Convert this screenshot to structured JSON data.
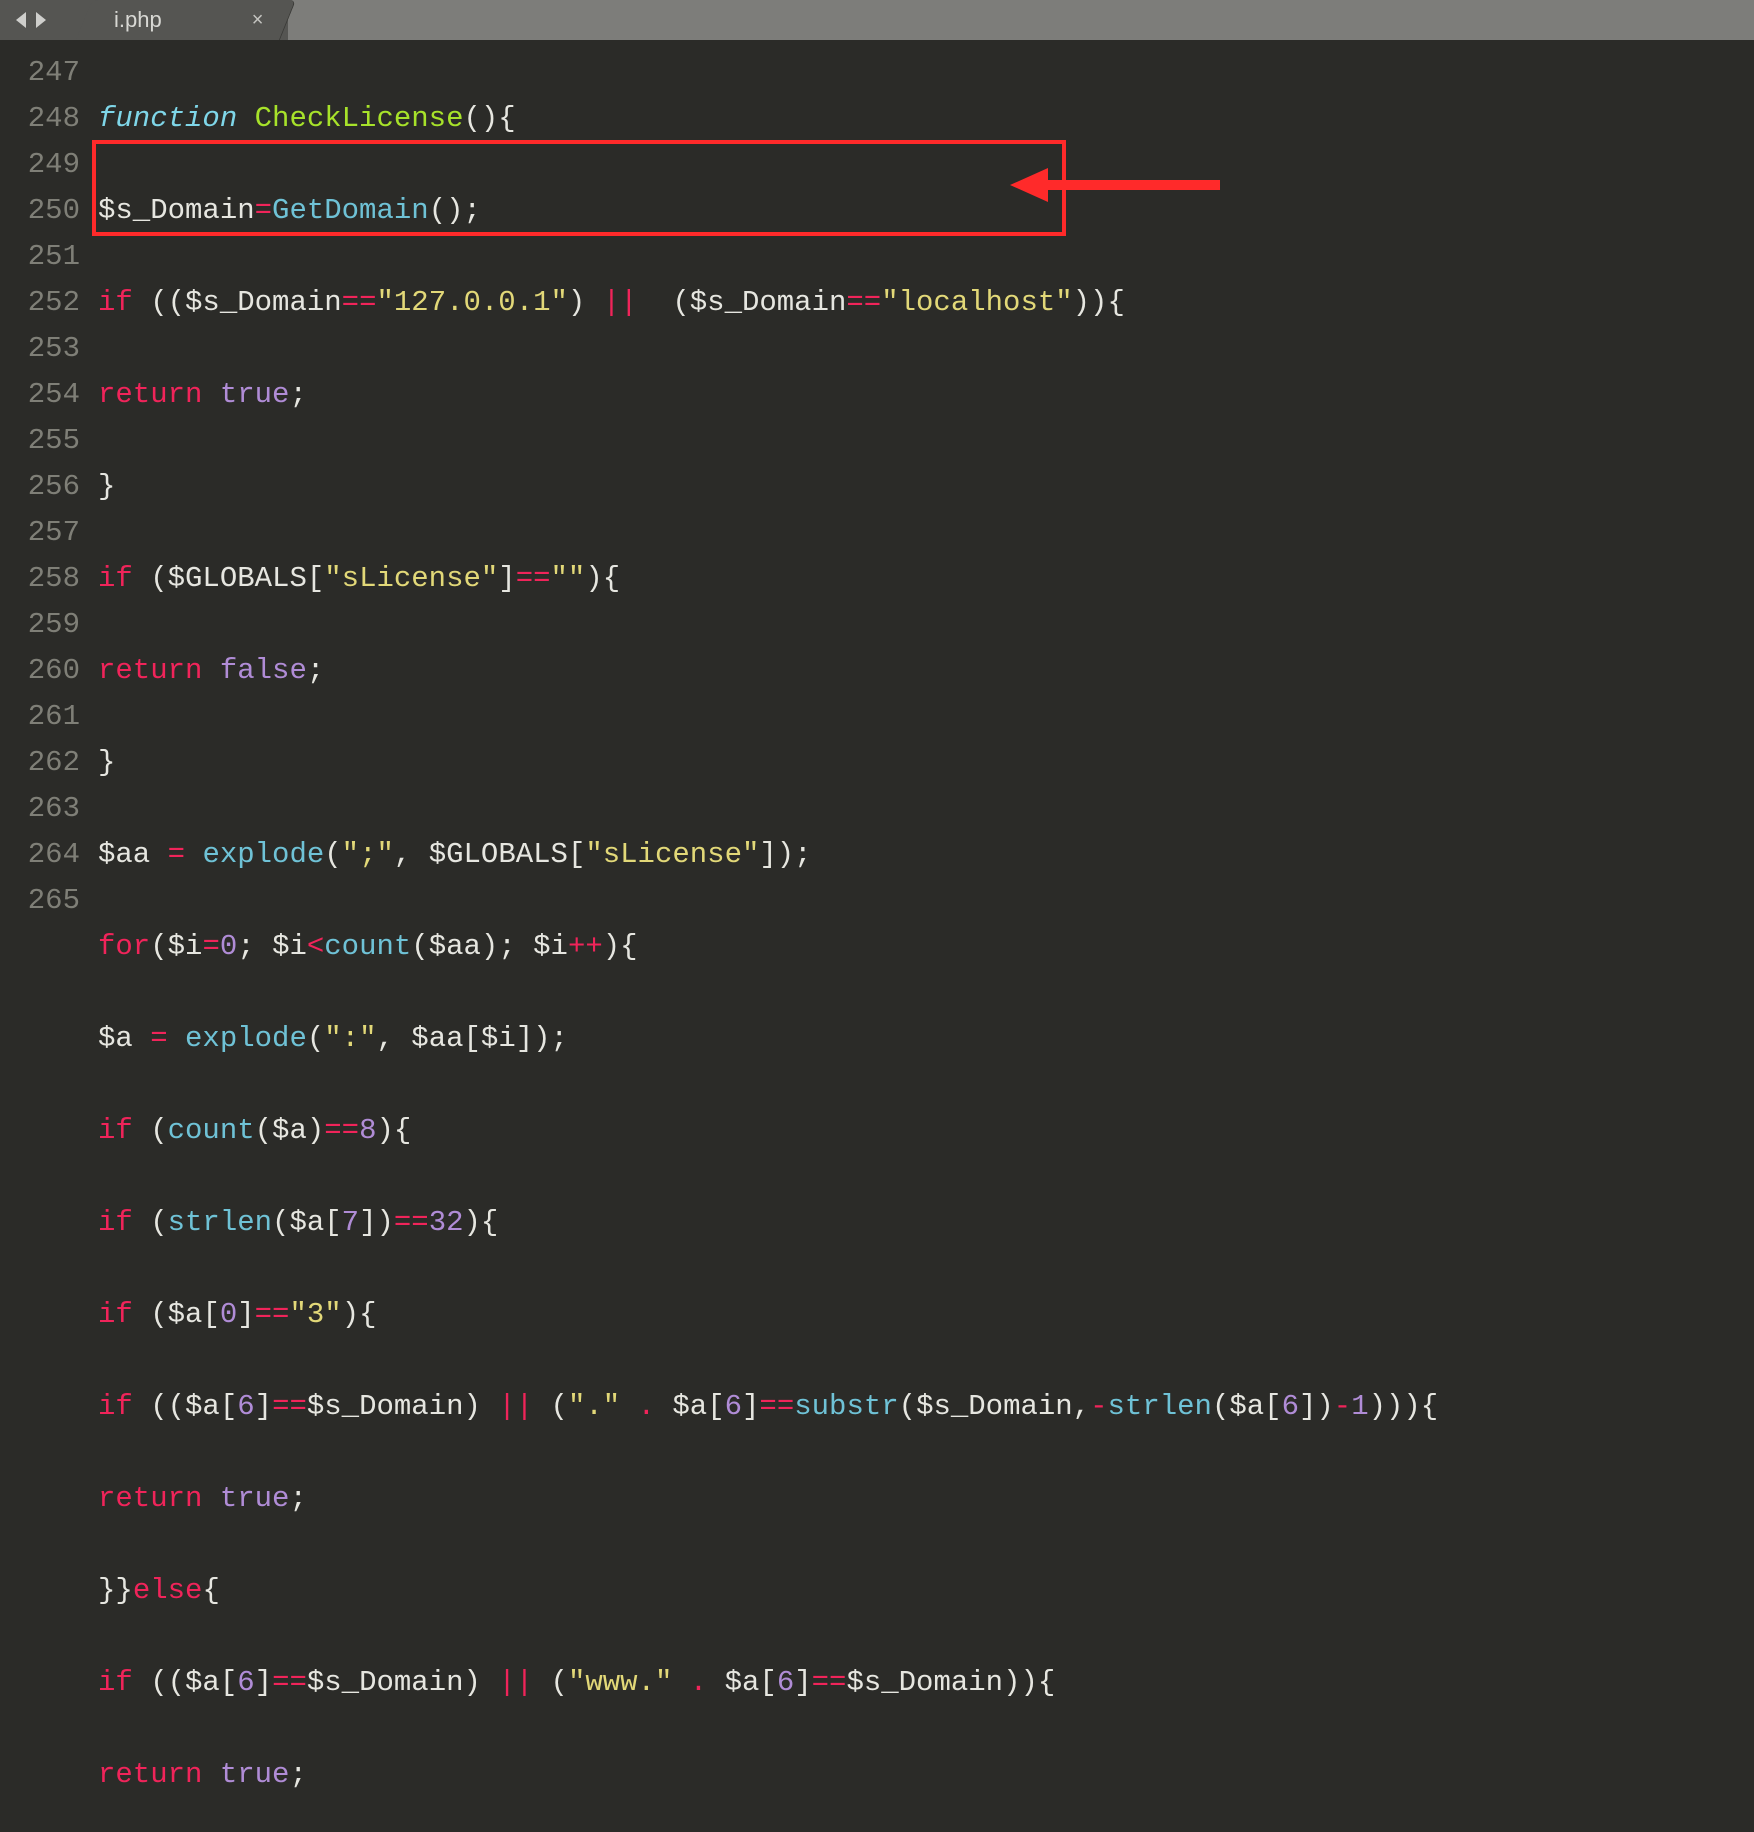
{
  "tab": {
    "filename": "i.php",
    "close_label": "×"
  },
  "nav": {
    "back": "◄",
    "forward": "►"
  },
  "gutter_start": 247,
  "lines": {
    "l247": {
      "indent": "",
      "t_function": "function",
      "t_space1": " ",
      "t_name": "CheckLicense",
      "t_parens": "()",
      "t_brace": "{"
    },
    "l248": {
      "t_var": "$s_Domain",
      "t_eq": "=",
      "t_call": "GetDomain",
      "t_rest": "();"
    },
    "l249": {
      "t_if": "if",
      "t_sp": " ",
      "t_open": "((",
      "t_var1": "$s_Domain",
      "t_eqeq1": "==",
      "t_str1": "\"127.0.0.1\"",
      "t_close1": ")",
      "t_sp2": " ",
      "t_or": "||",
      "t_sp3": "  ",
      "t_open2": "(",
      "t_var2": "$s_Domain",
      "t_eqeq2": "==",
      "t_str2": "\"localhost\"",
      "t_close2": ")){"
    },
    "l250": {
      "t_return": "return",
      "t_sp": " ",
      "t_true": "true",
      "t_semi": ";"
    },
    "l251": {
      "t_brace": "}"
    },
    "l252": {
      "t_if": "if",
      "t_sp": " ",
      "t_open": "(",
      "t_glob": "$GLOBALS",
      "t_br1": "[",
      "t_str": "\"sLicense\"",
      "t_br2": "]",
      "t_eqeq": "==",
      "t_str2": "\"\"",
      "t_close": "){"
    },
    "l253": {
      "t_return": "return",
      "t_sp": " ",
      "t_false": "false",
      "t_semi": ";"
    },
    "l254": {
      "t_brace": "}"
    },
    "l255": {
      "t_var": "$aa",
      "t_sp1": " ",
      "t_eq": "=",
      "t_sp2": " ",
      "t_call": "explode",
      "t_open": "(",
      "t_str": "\";\"",
      "t_comma": ", ",
      "t_glob": "$GLOBALS",
      "t_br1": "[",
      "t_str2": "\"sLicense\"",
      "t_br2": "]",
      "t_close": ");"
    },
    "l256": {
      "t_for": "for",
      "t_open": "(",
      "t_var1": "$i",
      "t_eq": "=",
      "t_zero": "0",
      "t_semi1": "; ",
      "t_var2": "$i",
      "t_lt": "<",
      "t_count": "count",
      "t_open2": "(",
      "t_aa": "$aa",
      "t_close2": "); ",
      "t_var3": "$i",
      "t_inc": "++",
      "t_close": "){"
    },
    "l257": {
      "t_var": "$a",
      "t_sp1": " ",
      "t_eq": "=",
      "t_sp2": " ",
      "t_call": "explode",
      "t_open": "(",
      "t_str": "\":\"",
      "t_comma": ", ",
      "t_aa": "$aa",
      "t_br1": "[",
      "t_i": "$i",
      "t_br2": "]",
      "t_close": ");"
    },
    "l258": {
      "t_if": "if",
      "t_sp": " ",
      "t_open": "(",
      "t_count": "count",
      "t_open2": "(",
      "t_a": "$a",
      "t_close2": ")",
      "t_eqeq": "==",
      "t_num": "8",
      "t_close": "){"
    },
    "l259": {
      "t_if": "if",
      "t_sp": " ",
      "t_open": "(",
      "t_strlen": "strlen",
      "t_open2": "(",
      "t_a": "$a",
      "t_br1": "[",
      "t_idx": "7",
      "t_br2": "]",
      "t_close2": ")",
      "t_eqeq": "==",
      "t_num": "32",
      "t_close": "){"
    },
    "l260": {
      "t_if": "if",
      "t_sp": " ",
      "t_open": "(",
      "t_a": "$a",
      "t_br1": "[",
      "t_idx": "0",
      "t_br2": "]",
      "t_eqeq": "==",
      "t_str": "\"3\"",
      "t_close": "){"
    },
    "l261": {
      "t_if": "if",
      "t_sp": " ",
      "t_open": "((",
      "t_a1": "$a",
      "t_br1": "[",
      "t_idx1": "6",
      "t_br2": "]",
      "t_eqeq1": "==",
      "t_dom1": "$s_Domain",
      "t_close1": ") ",
      "t_or": "||",
      "t_sp2": " (",
      "t_str1": "\".\"",
      "t_sp3": " ",
      "t_dot": ".",
      "t_sp4": " ",
      "t_a2": "$a",
      "t_br3": "[",
      "t_idx2": "6",
      "t_br4": "]",
      "t_eqeq2": "==",
      "t_substr": "substr",
      "t_open2": "(",
      "t_dom2": "$s_Domain",
      "t_comma": ",",
      "t_neg": "-",
      "t_strlen": "strlen",
      "t_open3": "(",
      "t_a3": "$a",
      "t_br5": "[",
      "t_idx3": "6",
      "t_br6": "]",
      "t_close3": ")",
      "t_minus": "-",
      "t_one": "1",
      "t_close": "))){"
    },
    "l262": {
      "t_return": "return",
      "t_sp": " ",
      "t_true": "true",
      "t_semi": ";"
    },
    "l263": {
      "t_braces": "}}",
      "t_else": "else",
      "t_brace2": "{"
    },
    "l264": {
      "t_if": "if",
      "t_sp": " ",
      "t_open": "((",
      "t_a1": "$a",
      "t_br1": "[",
      "t_idx1": "6",
      "t_br2": "]",
      "t_eqeq1": "==",
      "t_dom1": "$s_Domain",
      "t_close1": ") ",
      "t_or": "||",
      "t_sp2": " (",
      "t_str1": "\"www.\"",
      "t_sp3": " ",
      "t_dot": ".",
      "t_sp4": " ",
      "t_a2": "$a",
      "t_br3": "[",
      "t_idx2": "6",
      "t_br4": "]",
      "t_eqeq2": "==",
      "t_dom2": "$s_Domain",
      "t_close": ")){"
    },
    "l265": {
      "t_return": "return",
      "t_sp": " ",
      "t_true": "true",
      "t_semi": ";"
    }
  }
}
